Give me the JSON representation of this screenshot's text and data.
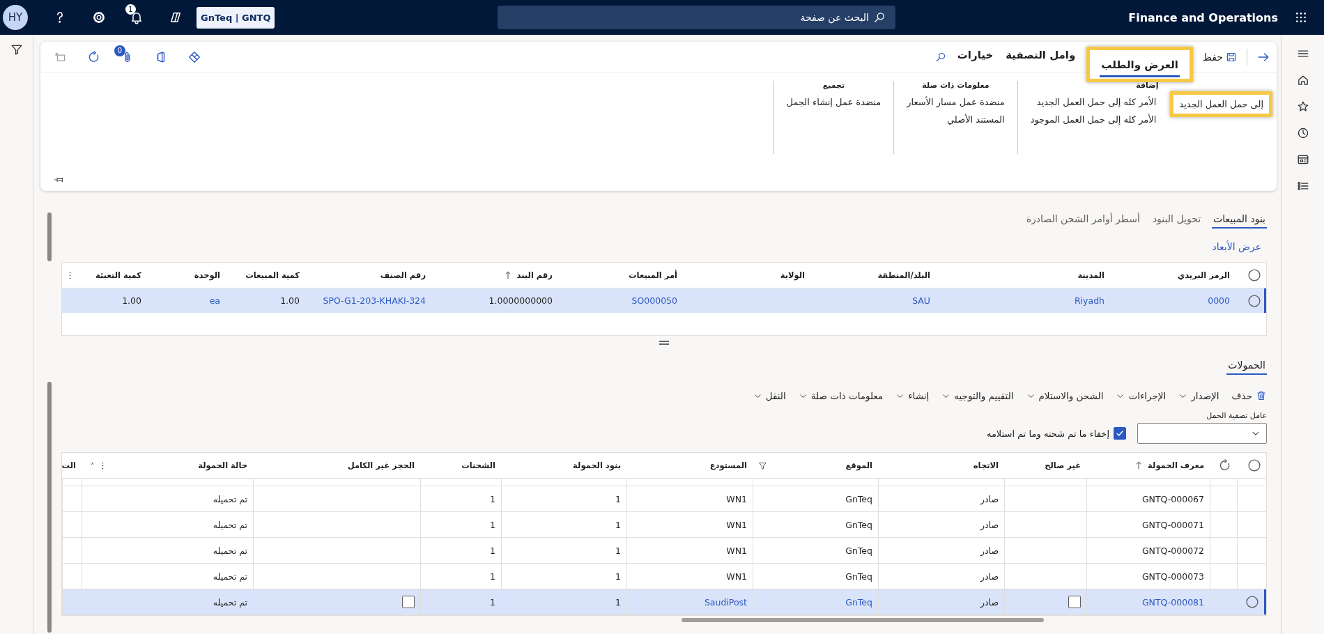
{
  "top_bar": {
    "avatar": "HY",
    "notification_count": "1",
    "company": "GnTeq | GNTQ",
    "search_placeholder": "البحث عن صفحة",
    "app_title": "Finance and Operations"
  },
  "action_pane": {
    "save": "حفظ",
    "attachment_count": "0",
    "tabs": [
      {
        "label": "العرض والطلب",
        "selected": true,
        "highlighted": true
      },
      {
        "label": "وامل التصفية",
        "selected": false,
        "highlighted": false
      },
      {
        "label": "خيارات",
        "selected": false,
        "highlighted": false
      }
    ]
  },
  "ribbon": {
    "groups": [
      {
        "label": "إضافة",
        "columns": [
          [
            {
              "label": "إلى حمل العمل الجديد",
              "highlighted": true
            }
          ],
          [
            {
              "label": "الأمر كله إلى حمل العمل الجديد",
              "highlighted": false
            },
            {
              "label": "الأمر كله إلى حمل العمل الموجود",
              "highlighted": false
            }
          ]
        ]
      },
      {
        "label": "معلومات ذات صلة",
        "columns": [
          [
            {
              "label": "منضدة عمل مسار الأسعار",
              "highlighted": false
            },
            {
              "label": "المستند الأصلي",
              "highlighted": false
            }
          ]
        ]
      },
      {
        "label": "تجميع",
        "columns": [
          [
            {
              "label": "منضدة عمل إنشاء الجمل",
              "highlighted": false
            }
          ]
        ]
      }
    ]
  },
  "detail_tabs": [
    {
      "label": "بنود المبيعات",
      "selected": true
    },
    {
      "label": "تحويل البنود",
      "selected": false
    },
    {
      "label": "أسطر أوامر الشحن الصادرة",
      "selected": false
    }
  ],
  "dimensions_link": "عرض الأبعاد",
  "lines_grid": {
    "all_selected": false,
    "columns": [
      {
        "label": "الرمز البريدي",
        "sorted": false
      },
      {
        "label": "المدينة",
        "sorted": false
      },
      {
        "label": "البلد/المنطقة",
        "sorted": false
      },
      {
        "label": "الولاية",
        "sorted": false
      },
      {
        "label": "أمر المبيعات",
        "sorted": false
      },
      {
        "label": "رقم البند",
        "sorted": true
      },
      {
        "label": "رقم الصنف",
        "sorted": false
      },
      {
        "label": "كمية المبيعات",
        "sorted": false
      },
      {
        "label": "الوحدة",
        "sorted": false
      },
      {
        "label": "كمية التعبئة",
        "sorted": false
      }
    ],
    "rows": [
      {
        "selected": true,
        "cells": [
          {
            "text": "0000",
            "link": true
          },
          {
            "text": "Riyadh",
            "link": true
          },
          {
            "text": "SAU",
            "link": true
          },
          "",
          {
            "text": "SO000050",
            "link": true
          },
          "1.0000000000",
          {
            "text": "SPO-G1-203-KHAKI-324",
            "link": true
          },
          "1.00",
          {
            "text": "ea",
            "link": true
          },
          "1.00"
        ]
      }
    ]
  },
  "loads": {
    "tab": "الحمولات",
    "toolbar": [
      {
        "label": "حذف",
        "kind": "delete"
      },
      {
        "label": "الإصدار",
        "kind": "menu"
      },
      {
        "label": "الإجراءات",
        "kind": "menu"
      },
      {
        "label": "الشحن والاستلام",
        "kind": "menu"
      },
      {
        "label": "التقييم والتوجيه",
        "kind": "menu"
      },
      {
        "label": "إنشاء",
        "kind": "menu"
      },
      {
        "label": "معلومات ذات صلة",
        "kind": "menu"
      },
      {
        "label": "النقل",
        "kind": "menu"
      }
    ],
    "filter_label": "عامل تصفية الحمل",
    "hide_shipped": {
      "label": "إخفاء ما تم شحنه وما تم استلامه",
      "checked": true
    },
    "grid": {
      "all_selected": false,
      "columns": [
        {
          "label": "معرف الحمولة",
          "sorted": true,
          "filtered": false
        },
        {
          "label": "غير صالح",
          "sorted": false,
          "filtered": false
        },
        {
          "label": "الاتجاه",
          "sorted": false,
          "filtered": false
        },
        {
          "label": "الموقع",
          "sorted": false,
          "filtered": true
        },
        {
          "label": "المستودع",
          "sorted": false,
          "filtered": false
        },
        {
          "label": "بنود الحمولة",
          "sorted": false,
          "filtered": false
        },
        {
          "label": "الشحنات",
          "sorted": false,
          "filtered": false
        },
        {
          "label": "الحجز غير الكامل",
          "sorted": false,
          "filtered": false
        },
        {
          "label": "حالة الحمولة",
          "sorted": false,
          "filtered": false
        },
        {
          "label": "الت",
          "sorted": false,
          "filtered": false
        }
      ],
      "rows": [
        {
          "selected": false,
          "cells": [
            "GNTQ-000067",
            null,
            "صادر",
            "GnTeq",
            "WN1",
            "1",
            "1",
            null,
            "تم تحميله",
            ""
          ]
        },
        {
          "selected": false,
          "cells": [
            "GNTQ-000071",
            null,
            "صادر",
            "GnTeq",
            "WN1",
            "1",
            "1",
            null,
            "تم تحميله",
            ""
          ]
        },
        {
          "selected": false,
          "cells": [
            "GNTQ-000072",
            null,
            "صادر",
            "GnTeq",
            "WN1",
            "1",
            "1",
            null,
            "تم تحميله",
            ""
          ]
        },
        {
          "selected": false,
          "cells": [
            "GNTQ-000073",
            null,
            "صادر",
            "GnTeq",
            "WN1",
            "1",
            "1",
            null,
            "تم تحميله",
            ""
          ]
        },
        {
          "selected": true,
          "cells": [
            {
              "text": "GNTQ-000081",
              "link": true
            },
            false,
            "صادر",
            {
              "text": "GnTeq",
              "link": true
            },
            {
              "text": "SaudiPost",
              "link": true
            },
            "1",
            "1",
            false,
            "تم تحميله",
            ""
          ]
        }
      ]
    }
  }
}
